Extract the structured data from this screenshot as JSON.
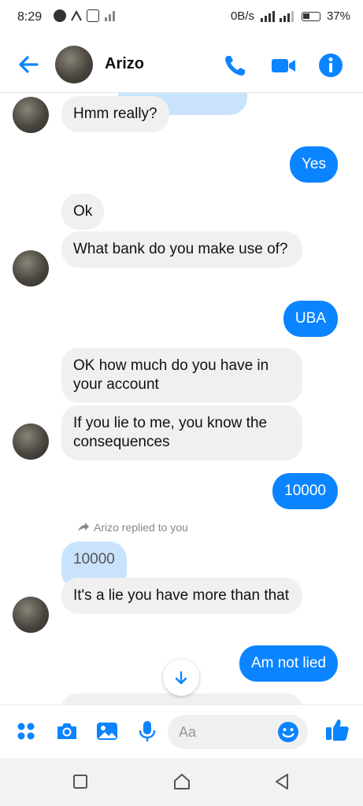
{
  "status_bar": {
    "time": "8:29",
    "data_rate": "0B/s",
    "battery": "37%"
  },
  "header": {
    "contact_name": "Arizo"
  },
  "messages": [
    {
      "side": "in",
      "text": "Hmm really?"
    },
    {
      "side": "out",
      "text": "Yes"
    },
    {
      "side": "in",
      "text": "Ok"
    },
    {
      "side": "in",
      "text": "What bank do you make use of?"
    },
    {
      "side": "out",
      "text": "UBA"
    },
    {
      "side": "in",
      "text": "OK how much do you have in your account"
    },
    {
      "side": "in",
      "text": "If you lie to me, you know the consequences"
    },
    {
      "side": "out",
      "text": "10000"
    },
    {
      "side": "note",
      "text": "Arizo replied to you"
    },
    {
      "side": "quoted",
      "text": "10000"
    },
    {
      "side": "in",
      "text": "It's a lie you have more than that"
    },
    {
      "side": "out",
      "text": "Am not lied"
    }
  ],
  "composer": {
    "placeholder": "Aa"
  },
  "icons": {
    "back": "arrow-left-icon",
    "call": "phone-icon",
    "video": "video-camera-icon",
    "info": "info-icon",
    "menu": "four-dots-icon",
    "camera": "camera-icon",
    "gallery": "image-icon",
    "mic": "microphone-icon",
    "emoji": "smiley-icon",
    "like": "thumbs-up-icon"
  },
  "colors": {
    "accent": "#0b84ff",
    "incoming_bubble": "#f1f0f0",
    "quoted_bubble": "#c9e3fd"
  }
}
